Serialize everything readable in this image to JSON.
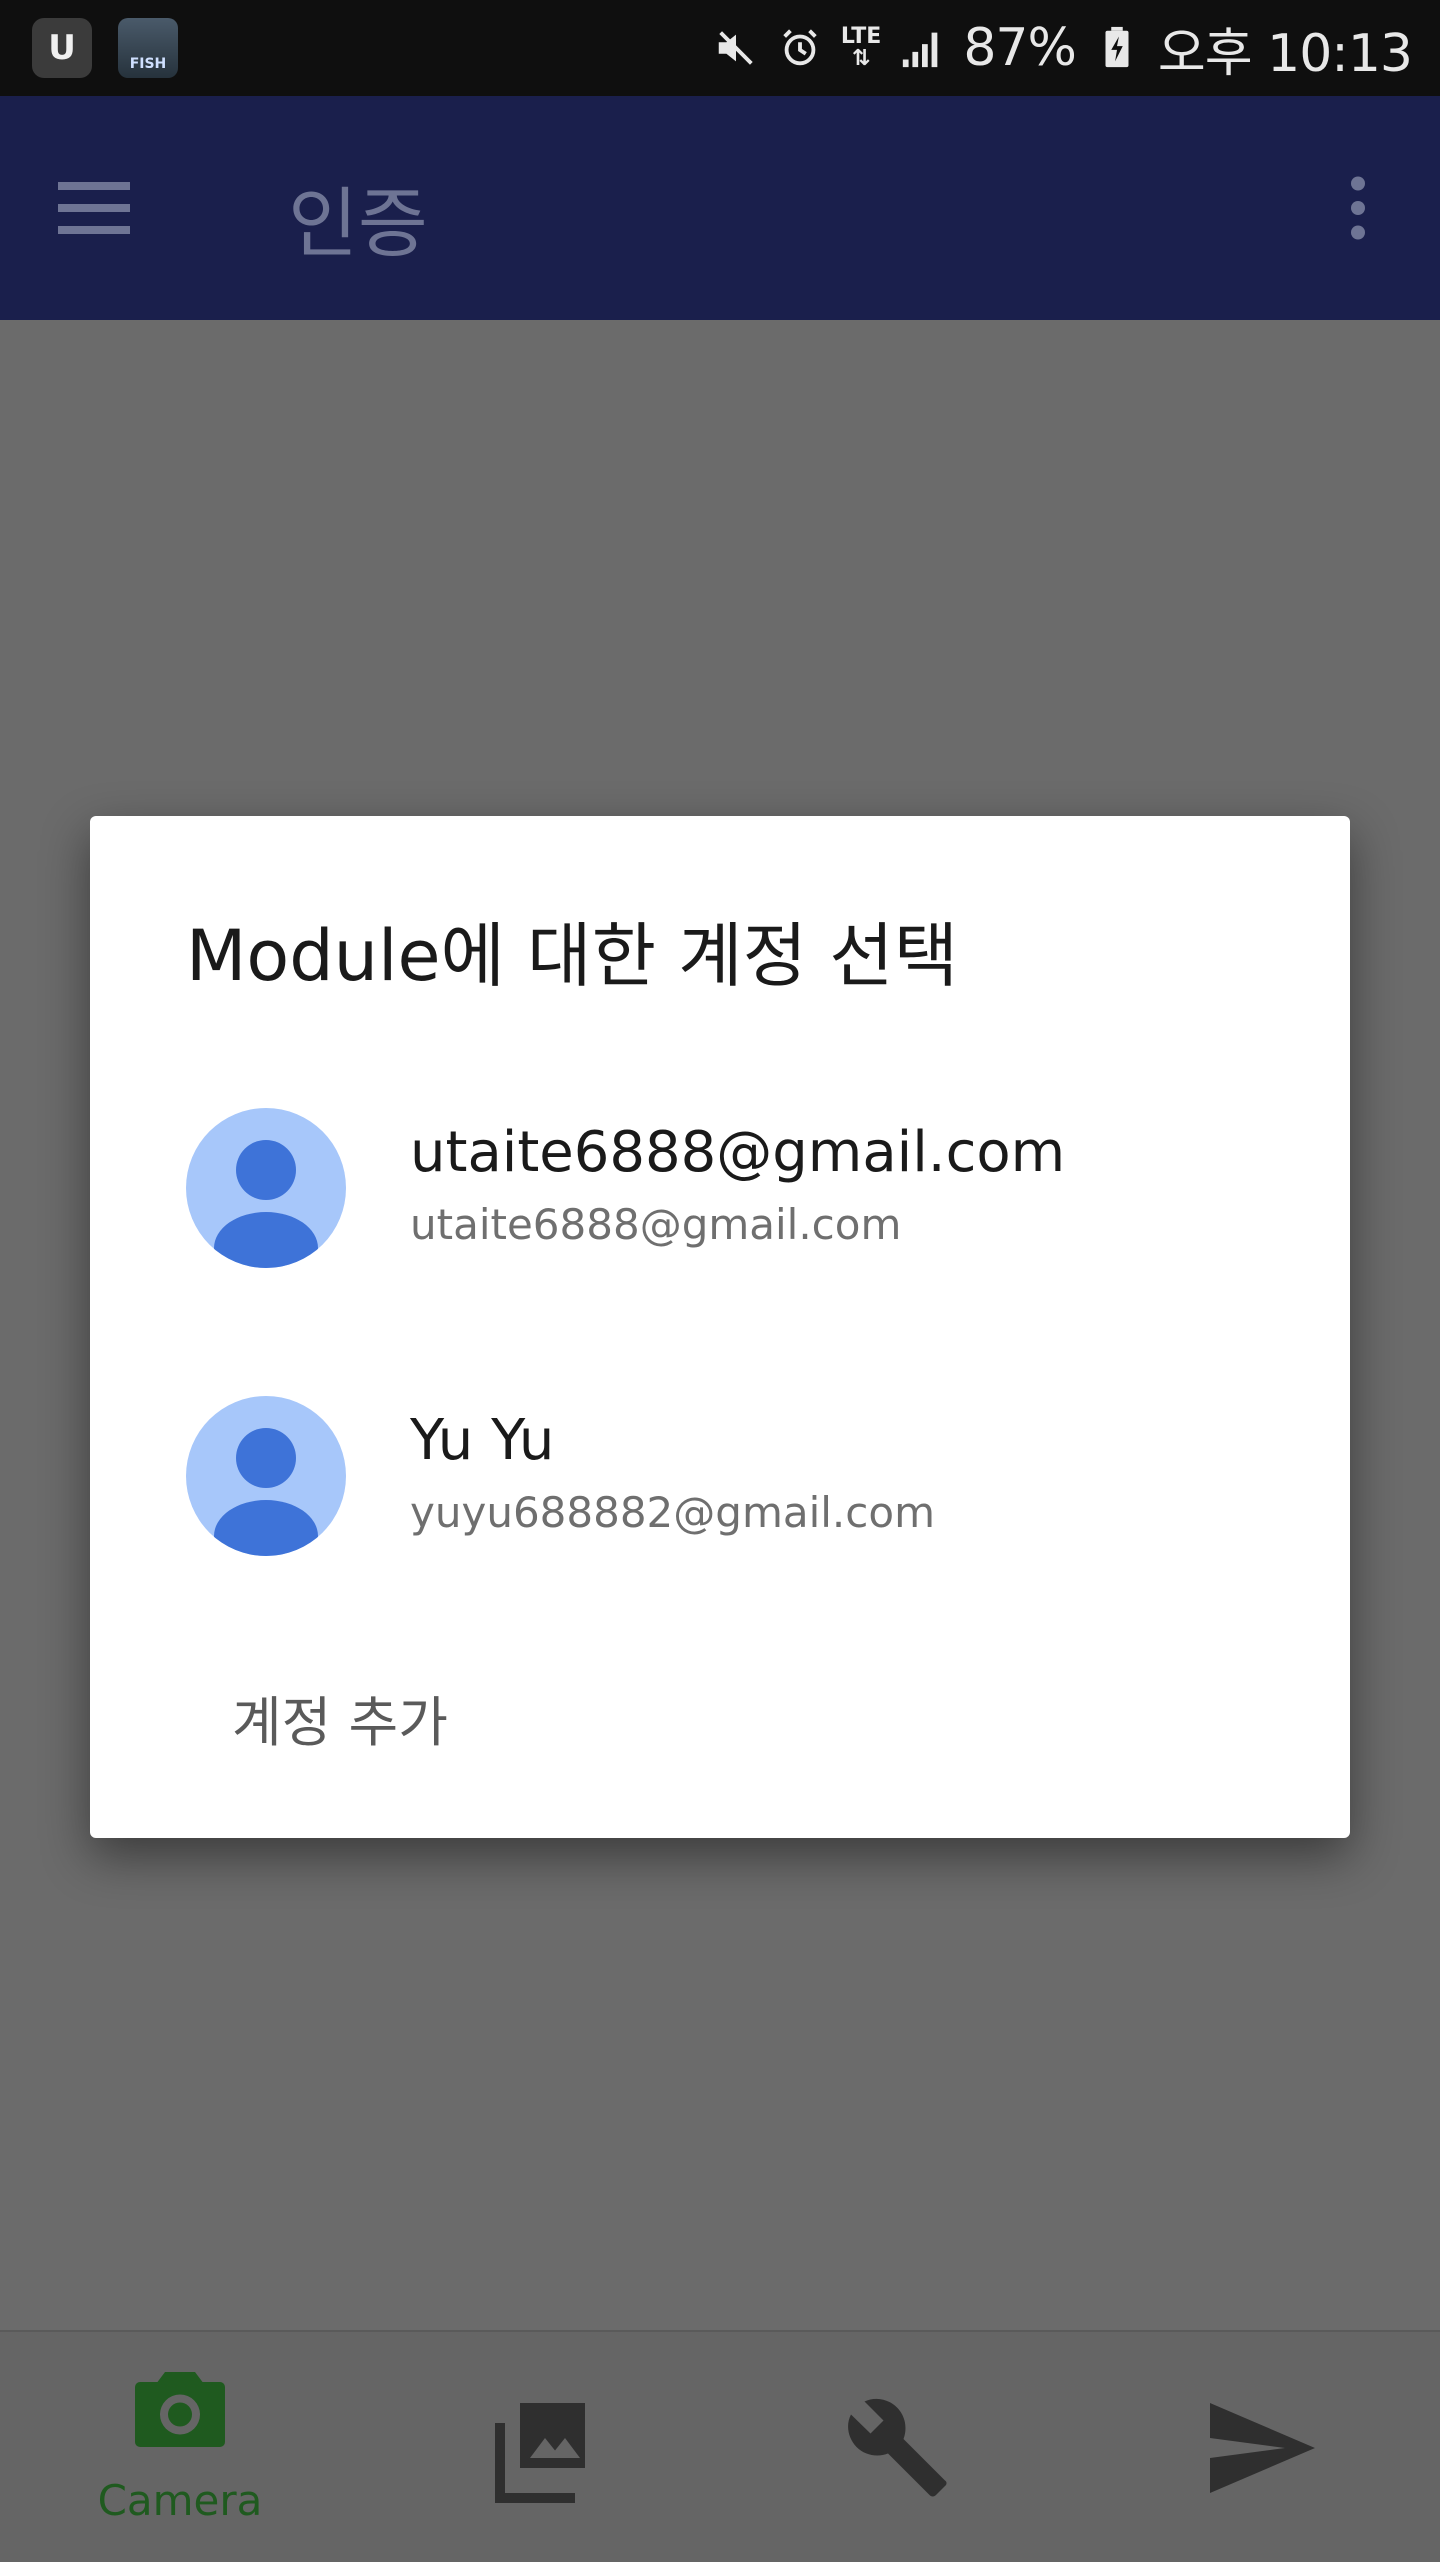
{
  "status_bar": {
    "notification_icons": [
      "u-app-icon",
      "fish-game-icon"
    ],
    "game_icon_text": "FISH",
    "network_type": "LTE",
    "battery_percent": "87%",
    "time": "오후 10:13",
    "status_icons": [
      "mute-icon",
      "alarm-icon",
      "lte-data-icon",
      "signal-icon",
      "battery-charging-icon"
    ]
  },
  "app_bar": {
    "title": "인증",
    "background_color": "#1a1f4c"
  },
  "dialog": {
    "title": "Module에 대한 계정 선택",
    "accounts": [
      {
        "name": "utaite6888@gmail.com",
        "email": "utaite6888@gmail.com"
      },
      {
        "name": "Yu Yu",
        "email": "yuyu688882@gmail.com"
      }
    ],
    "add_account_label": "계정 추가",
    "avatar_color": "#a7c7fa",
    "avatar_figure_color": "#3e73d8"
  },
  "bottom_nav": {
    "items": [
      {
        "label": "Camera",
        "icon": "camera-icon",
        "active": true
      },
      {
        "label": "",
        "icon": "gallery-icon",
        "active": false
      },
      {
        "label": "",
        "icon": "wrench-icon",
        "active": false
      },
      {
        "label": "",
        "icon": "send-icon",
        "active": false
      }
    ],
    "active_color": "#1f5a1f"
  }
}
